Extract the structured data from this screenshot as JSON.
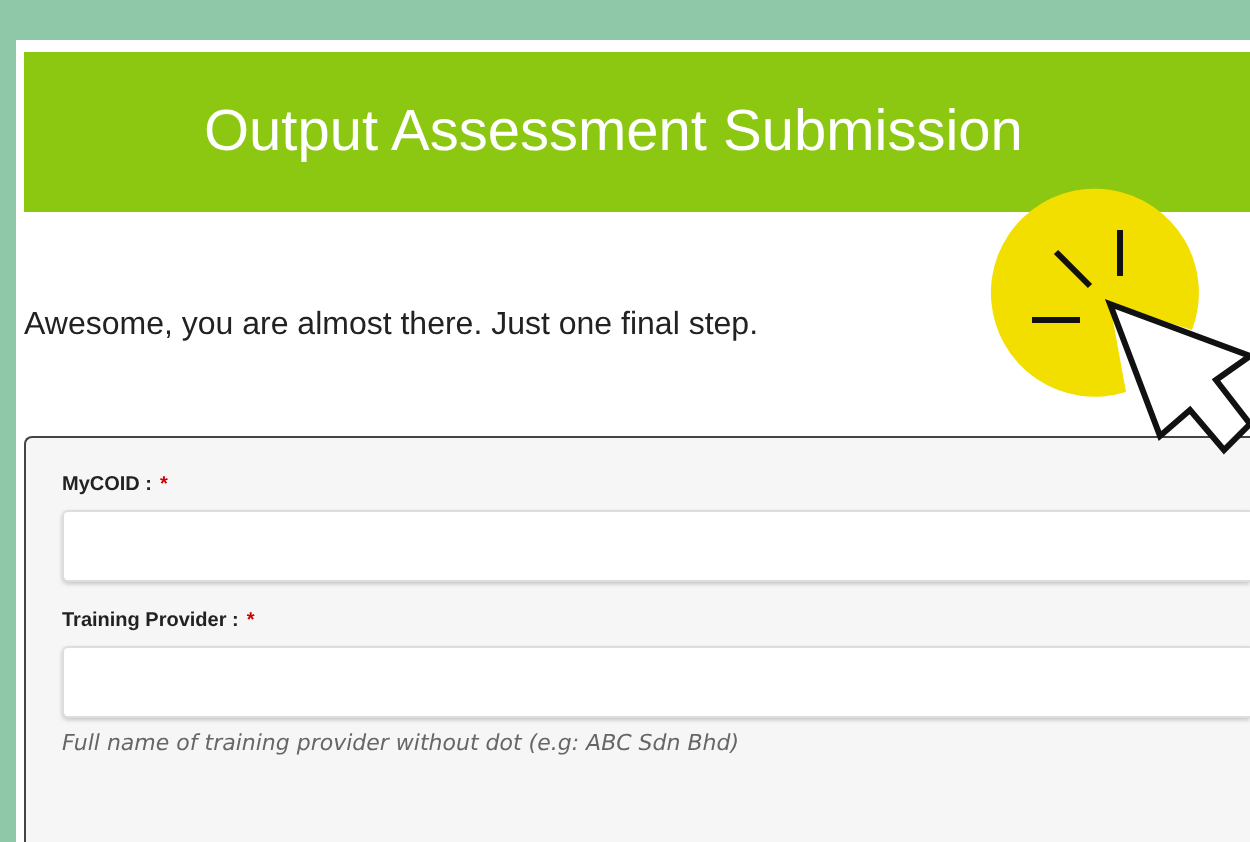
{
  "header": {
    "title": "Output Assessment Submission"
  },
  "intro": "Awesome, you are almost there. Just one final step.",
  "form": {
    "fields": [
      {
        "label": "MyCOID :",
        "required_mark": "*"
      },
      {
        "label": "Training Provider :",
        "required_mark": "*",
        "help": "Full name of training provider without dot (e.g: ABC Sdn Bhd)"
      }
    ]
  }
}
